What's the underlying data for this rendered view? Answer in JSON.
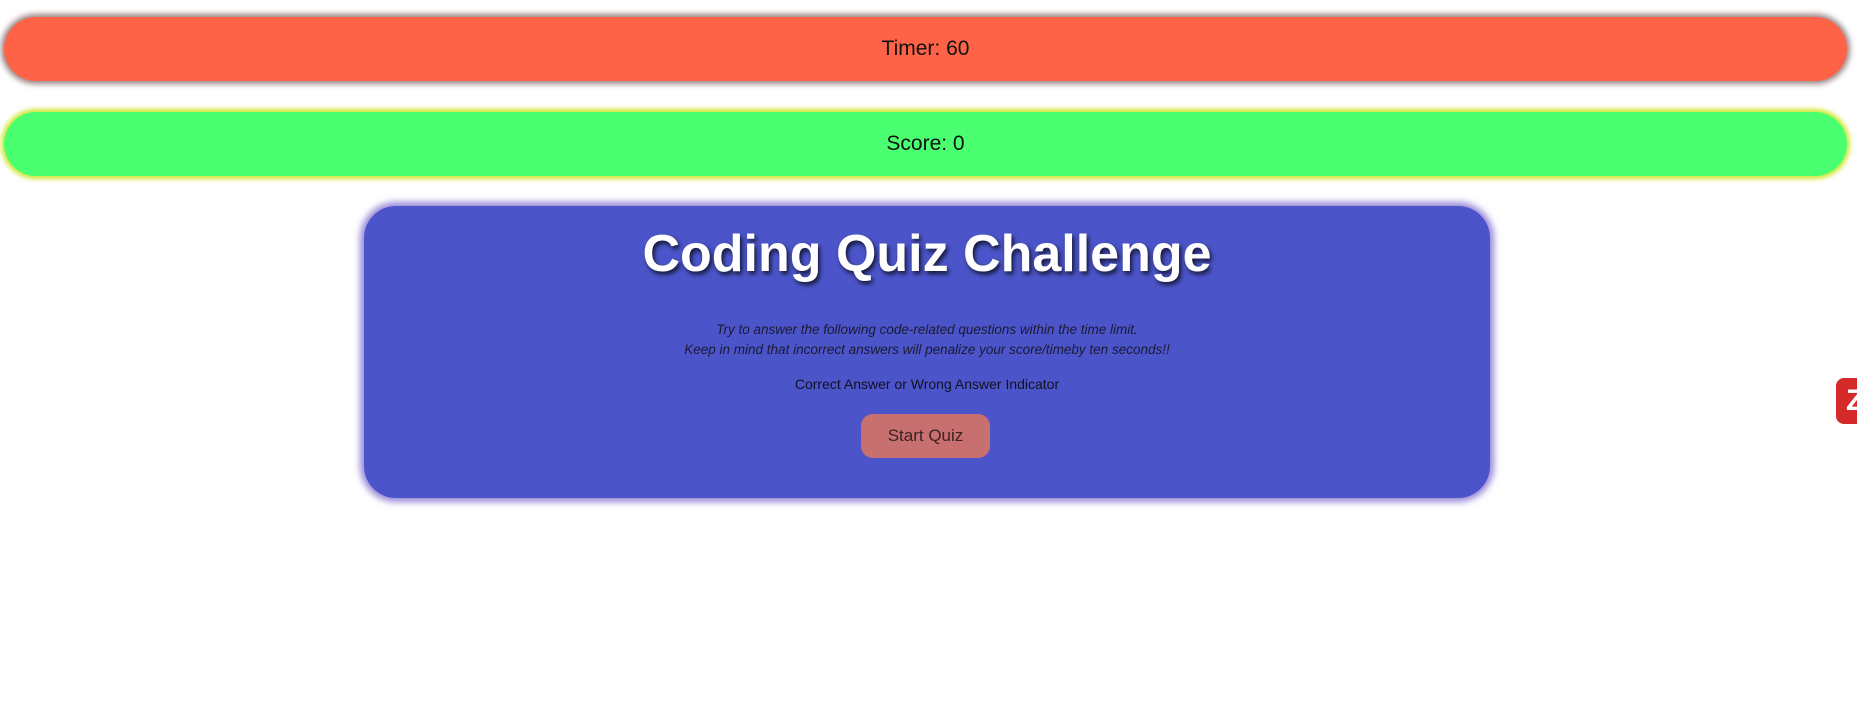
{
  "timer": {
    "label": "Timer: 60",
    "color": "#ff6347"
  },
  "score": {
    "label": "Score: 0",
    "color": "#4aff70"
  },
  "quiz": {
    "title": "Coding Quiz Challenge",
    "instructions": [
      "Try to answer the following code-related questions within the time limit.",
      "Keep in mind that incorrect answers will penalize your score/timeby ten seconds!!"
    ],
    "indicator": "Correct Answer or Wrong Answer Indicator",
    "start_button": "Start Quiz",
    "card_color": "#4b55c9",
    "button_color": "#c87070"
  },
  "side_widget": {
    "icon": "z-badge-icon",
    "glyph": "Z",
    "color": "#d42a2a"
  }
}
